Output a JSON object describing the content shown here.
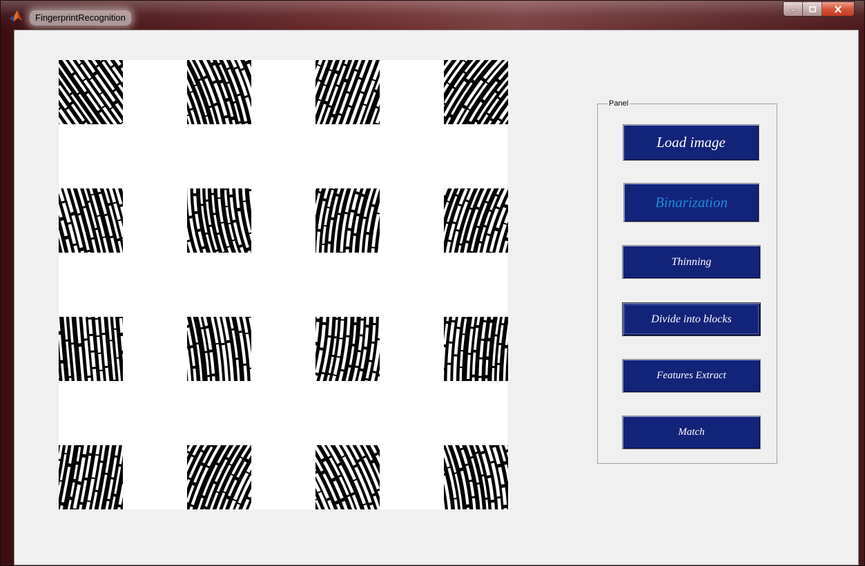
{
  "window": {
    "title": "FingerprintRecognition"
  },
  "panel": {
    "title": "Panel",
    "buttons": {
      "load": "Load image",
      "binarization": "Binarization",
      "thinning": "Thinning",
      "divide": "Divide into blocks",
      "features": "Features Extract",
      "match": "Match"
    }
  },
  "image_grid": {
    "rows": 4,
    "cols": 4,
    "description_colors": {
      "ridge": "#ffffff",
      "background": "#000000"
    }
  },
  "colors": {
    "button_bg": "#12237a",
    "button_text": "#ffffff",
    "binarization_text": "#1a8fd8",
    "client_bg": "#f0f0f0"
  }
}
